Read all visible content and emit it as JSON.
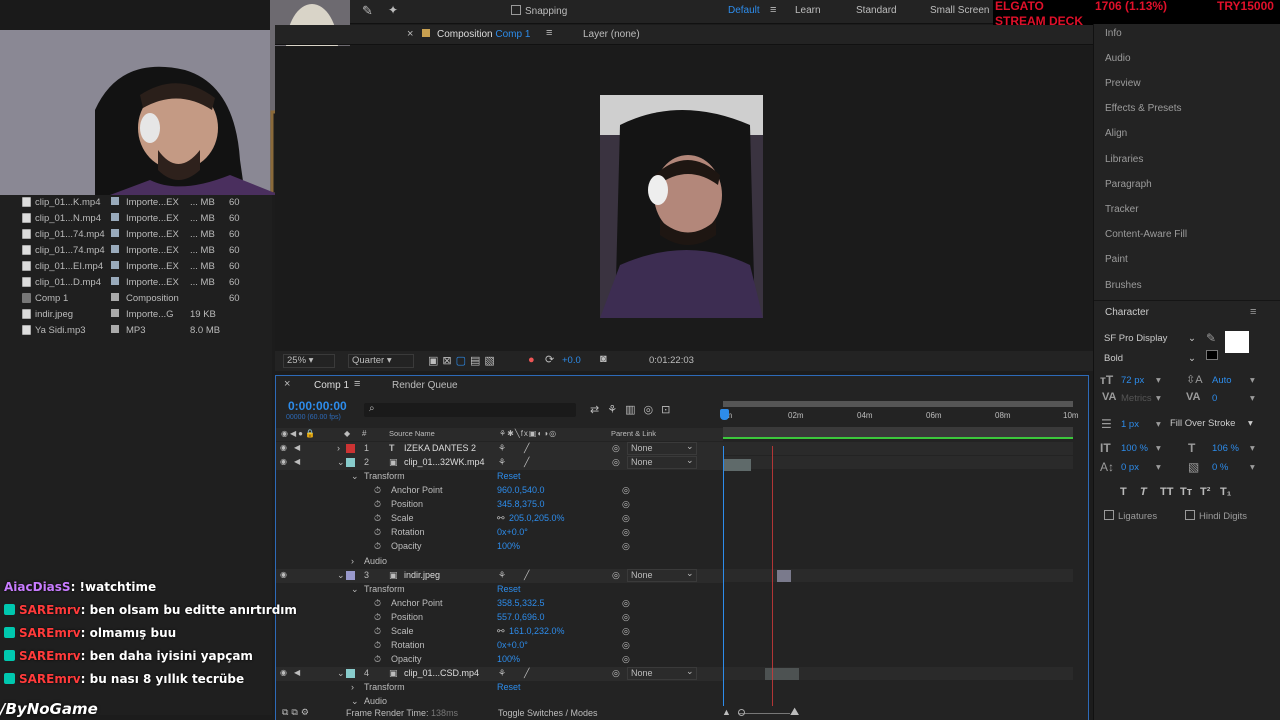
{
  "toolbar": {
    "snapping": "Snapping",
    "workspaces": [
      "Default",
      "Learn",
      "Standard",
      "Small Screen"
    ]
  },
  "stream_overlay": {
    "sponsor_line1": "ELGATO",
    "sponsor_line2": "STREAM DECK",
    "stat": "1706 (1.13%)",
    "currency": "TRY15000"
  },
  "comp_tabs": {
    "composition_prefix": "Composition",
    "composition_name": "Comp 1",
    "layer_label": "Layer (none)"
  },
  "project": {
    "rows": [
      {
        "name": "clip_01...K.mp4",
        "type": "Importe...EX",
        "size": "... MB",
        "fps": "60",
        "color": "#9ab"
      },
      {
        "name": "clip_01...N.mp4",
        "type": "Importe...EX",
        "size": "... MB",
        "fps": "60",
        "color": "#9ab"
      },
      {
        "name": "clip_01...74.mp4",
        "type": "Importe...EX",
        "size": "... MB",
        "fps": "60",
        "color": "#9ab"
      },
      {
        "name": "clip_01...74.mp4",
        "type": "Importe...EX",
        "size": "... MB",
        "fps": "60",
        "color": "#9ab"
      },
      {
        "name": "clip_01...EI.mp4",
        "type": "Importe...EX",
        "size": "... MB",
        "fps": "60",
        "color": "#9ab"
      },
      {
        "name": "clip_01...D.mp4",
        "type": "Importe...EX",
        "size": "... MB",
        "fps": "60",
        "color": "#9ab"
      },
      {
        "name": "Comp 1",
        "type": "Composition",
        "size": "",
        "fps": "60",
        "color": "#aaa"
      },
      {
        "name": "indir.jpeg",
        "type": "Importe...G",
        "size": "19 KB",
        "fps": "",
        "color": "#aaa"
      },
      {
        "name": "Ya Sidi.mp3",
        "type": "MP3",
        "size": "8.0 MB",
        "fps": "",
        "color": "#aaa"
      }
    ]
  },
  "viewer_footer": {
    "zoom": "25%",
    "resolution": "Quarter",
    "exposure": "+0.0",
    "timecode": "0:01:22:03"
  },
  "timeline": {
    "tabs": [
      "Comp 1",
      "Render Queue"
    ],
    "current_time": "0:00:00:00",
    "current_frames": "00000 (60.00 fps)",
    "col_source": "Source Name",
    "col_parent": "Parent & Link",
    "ruler": [
      "0m",
      "02m",
      "04m",
      "06m",
      "08m",
      "10m"
    ],
    "layers": [
      {
        "num": "1",
        "name": "IZEKA DANTES 2",
        "parent": "None",
        "color": "#c33"
      },
      {
        "num": "2",
        "name": "clip_01...32WK.mp4",
        "parent": "None",
        "color": "#8cc"
      },
      {
        "num": "3",
        "name": "indir.jpeg",
        "parent": "None",
        "color": "#99c"
      },
      {
        "num": "4",
        "name": "clip_01...CSD.mp4",
        "parent": "None",
        "color": "#8cc"
      }
    ],
    "transform": "Transform",
    "reset": "Reset",
    "audio": "Audio",
    "props": [
      "Anchor Point",
      "Position",
      "Scale",
      "Rotation",
      "Opacity"
    ],
    "layer2_values": [
      "960.0,540.0",
      "345.8,375.0",
      "205.0,205.0%",
      "0x+0.0°",
      "100%"
    ],
    "layer3_values": [
      "358.5,332.5",
      "557.0,696.0",
      "161.0,232.0%",
      "0x+0.0°",
      "100%"
    ],
    "footer_render": "Frame Render Time:",
    "footer_render_val": "138ms",
    "footer_toggle": "Toggle Switches / Modes"
  },
  "right_panel": {
    "items": [
      "Info",
      "Audio",
      "Preview",
      "Effects & Presets",
      "Align",
      "Libraries",
      "Paragraph",
      "Tracker",
      "Content-Aware Fill",
      "Paint",
      "Brushes"
    ],
    "character_title": "Character",
    "font_family": "SF Pro Display",
    "font_style": "Bold",
    "font_size": "72 px",
    "leading": "Auto",
    "kerning": "Metrics",
    "tracking": "0",
    "stroke_width": "1 px",
    "stroke_type": "Fill Over Stroke",
    "vscale": "100 %",
    "hscale": "106 %",
    "baseline": "0 px",
    "tsume": "0 %",
    "ligatures": "Ligatures",
    "hindi_digits": "Hindi Digits",
    "type_styles": [
      "T",
      "T",
      "TT",
      "Tт",
      "T²",
      "T₁"
    ]
  },
  "chat": [
    {
      "user": "AiacDiasS",
      "user_color": "#c87cff",
      "badge": false,
      "msg": ": !watchtime"
    },
    {
      "user": "SAREmrv",
      "user_color": "#ff3b3b",
      "badge": true,
      "msg": ": ben olsam bu editte anırtırdım"
    },
    {
      "user": "SAREmrv",
      "user_color": "#ff3b3b",
      "badge": true,
      "msg": ": olmamış buu"
    },
    {
      "user": "SAREmrv",
      "user_color": "#ff3b3b",
      "badge": true,
      "msg": ": ben daha iyisini yapçam"
    },
    {
      "user": "SAREmrv",
      "user_color": "#ff3b3b",
      "badge": true,
      "msg": ": bu nası 8 yıllık tecrübe"
    }
  ],
  "watermark": "ByNoGame",
  "colors": {
    "accent": "#2d8ceb",
    "playhead": "#d43a3a",
    "workarea": "#3cc83c"
  }
}
